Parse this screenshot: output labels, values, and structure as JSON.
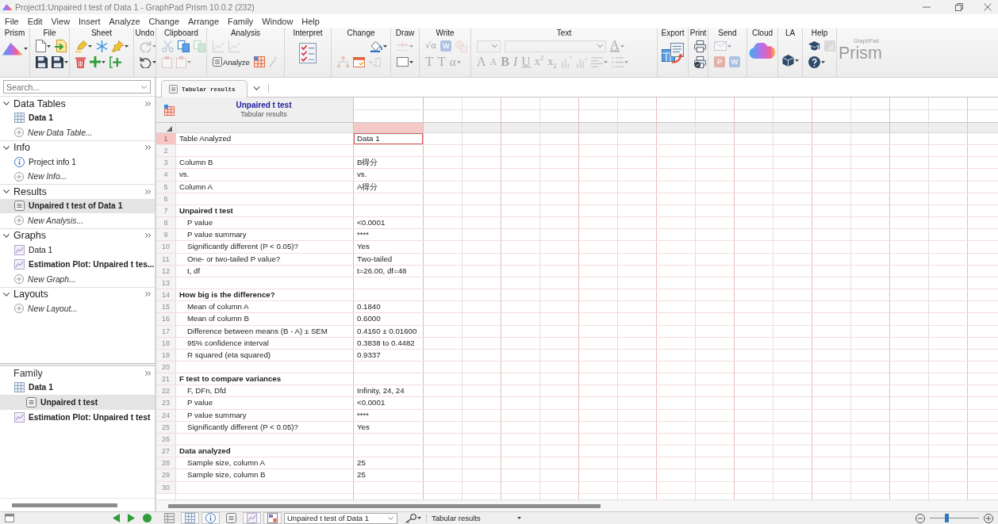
{
  "window": {
    "title": "Project1:Unpaired t test of Data 1 - GraphPad Prism 10.0.2 (232)"
  },
  "menu": [
    "File",
    "Edit",
    "View",
    "Insert",
    "Analyze",
    "Change",
    "Arrange",
    "Family",
    "Window",
    "Help"
  ],
  "ribbon": {
    "groups": [
      {
        "label": "Prism",
        "rows": [
          [
            {
              "kind": "icon",
              "disabled": false,
              "dropdown": true
            }
          ]
        ]
      },
      {
        "label": "File",
        "rows": [
          [
            {
              "kind": "icon",
              "disabled": false,
              "dropdown": true
            },
            {
              "kind": "icon",
              "disabled": false,
              "dropdown": false
            }
          ],
          [
            {
              "kind": "icon",
              "disabled": false,
              "dropdown": false
            },
            {
              "kind": "icon",
              "disabled": false,
              "dropdown": true
            }
          ]
        ]
      },
      {
        "label": "Sheet",
        "rows": [
          [
            {
              "kind": "icon",
              "disabled": false,
              "dropdown": true
            },
            {
              "kind": "icon",
              "disabled": false,
              "dropdown": false
            },
            {
              "kind": "icon",
              "disabled": false,
              "dropdown": true
            }
          ],
          [
            {
              "kind": "icon",
              "disabled": false,
              "dropdown": false
            },
            {
              "kind": "icon",
              "disabled": false,
              "dropdown": true
            },
            {
              "kind": "icon",
              "disabled": false,
              "dropdown": false
            }
          ]
        ]
      },
      {
        "label": "Undo",
        "rows": [
          [
            {
              "kind": "icon",
              "disabled": true,
              "dropdown": true
            }
          ],
          [
            {
              "kind": "icon",
              "disabled": false,
              "dropdown": true
            }
          ]
        ]
      },
      {
        "label": "Clipboard",
        "rows": [
          [
            {
              "kind": "icon",
              "disabled": true,
              "dropdown": false
            },
            {
              "kind": "icon",
              "disabled": false,
              "dropdown": false
            },
            {
              "kind": "icon",
              "disabled": true,
              "dropdown": false
            }
          ],
          [
            {
              "kind": "icon",
              "disabled": true,
              "dropdown": false
            },
            {
              "kind": "icon",
              "disabled": true,
              "dropdown": true
            }
          ]
        ]
      },
      {
        "label": "Analysis",
        "rows": [
          [
            {
              "kind": "icon",
              "disabled": true,
              "dropdown": false
            },
            {
              "kind": "icon",
              "disabled": true,
              "dropdown": false
            }
          ],
          [
            {
              "kind": "button",
              "label": "Analyze",
              "disabled": false,
              "dropdown": false
            },
            {
              "kind": "icon",
              "disabled": false,
              "dropdown": false
            },
            {
              "kind": "icon",
              "disabled": true,
              "dropdown": false
            }
          ]
        ]
      },
      {
        "label": "Interpret",
        "rows": [
          [
            {
              "kind": "icon",
              "disabled": false,
              "dropdown": false
            }
          ]
        ]
      },
      {
        "label": "Change",
        "rows": [
          [
            {
              "kind": "icon",
              "disabled": false,
              "dropdown": true
            }
          ],
          [
            {
              "kind": "icon",
              "disabled": true,
              "dropdown": false
            },
            {
              "kind": "icon",
              "disabled": false,
              "dropdown": false
            },
            {
              "kind": "icon",
              "disabled": true,
              "dropdown": false
            }
          ]
        ]
      },
      {
        "label": "Draw",
        "rows": [
          [
            {
              "kind": "icon",
              "disabled": true,
              "dropdown": true
            }
          ],
          [
            {
              "kind": "icon",
              "disabled": false,
              "dropdown": true
            }
          ]
        ]
      },
      {
        "label": "Write",
        "rows": [
          [
            {
              "kind": "glyph",
              "label": "√α",
              "disabled": true,
              "dropdown": false
            },
            {
              "kind": "tile",
              "label": "W",
              "disabled": true,
              "dropdown": false
            },
            {
              "kind": "icon",
              "disabled": true,
              "dropdown": false
            }
          ],
          [
            {
              "kind": "glyph",
              "label": "T",
              "disabled": true,
              "dropdown": false
            },
            {
              "kind": "glyph",
              "label": "T",
              "disabled": true,
              "dropdown": false
            },
            {
              "kind": "glyph",
              "label": "α",
              "disabled": true,
              "dropdown": true
            }
          ]
        ]
      },
      {
        "label": "Text",
        "rows": [
          [
            {
              "kind": "field",
              "disabled": true,
              "dropdown": true
            },
            {
              "kind": "field",
              "disabled": true,
              "dropdown": true
            },
            {
              "kind": "glyph",
              "label": "A",
              "disabled": true,
              "dropdown": true
            }
          ],
          [
            {
              "kind": "glyph",
              "label": "A",
              "disabled": true,
              "dropdown": false
            },
            {
              "kind": "glyph",
              "label": "A",
              "disabled": true,
              "dropdown": false
            },
            {
              "kind": "glyph",
              "label": "B",
              "disabled": true,
              "dropdown": false
            },
            {
              "kind": "glyph",
              "label": "I",
              "disabled": true,
              "dropdown": false
            },
            {
              "kind": "glyph",
              "label": "U",
              "disabled": true,
              "dropdown": false
            },
            {
              "kind": "glyph",
              "label": "x$^{2}$",
              "disabled": true,
              "dropdown": false
            },
            {
              "kind": "glyph",
              "label": "x$_{2}$",
              "disabled": true,
              "dropdown": false
            },
            {
              "kind": "icon",
              "disabled": true,
              "dropdown": false
            },
            {
              "kind": "icon",
              "disabled": true,
              "dropdown": false
            },
            {
              "kind": "icon",
              "disabled": true,
              "dropdown": true
            },
            {
              "kind": "icon",
              "disabled": true,
              "dropdown": true
            }
          ]
        ]
      },
      {
        "label": "Export",
        "rows": [
          [
            {
              "kind": "icon",
              "disabled": false,
              "dropdown": false
            }
          ]
        ]
      },
      {
        "label": "Print",
        "rows": [
          [
            {
              "kind": "icon",
              "disabled": false,
              "dropdown": false
            }
          ],
          [
            {
              "kind": "icon",
              "disabled": false,
              "dropdown": false
            }
          ]
        ]
      },
      {
        "label": "Send",
        "rows": [
          [
            {
              "kind": "icon",
              "disabled": true,
              "dropdown": true
            }
          ],
          [
            {
              "kind": "tile",
              "label": "P",
              "disabled": true,
              "dropdown": false
            },
            {
              "kind": "tile",
              "label": "W",
              "disabled": true,
              "dropdown": false
            }
          ]
        ]
      },
      {
        "label": "Cloud",
        "rows": [
          [
            {
              "kind": "icon",
              "disabled": false,
              "dropdown": false
            }
          ]
        ]
      },
      {
        "label": "LA",
        "rows": [
          [
            {
              "kind": "icon",
              "disabled": false,
              "dropdown": true
            }
          ]
        ]
      },
      {
        "label": "Help",
        "rows": [
          [
            {
              "kind": "icon",
              "disabled": false,
              "dropdown": false
            },
            {
              "kind": "icon",
              "disabled": true,
              "dropdown": false
            }
          ],
          [
            {
              "kind": "icon",
              "disabled": false,
              "dropdown": true
            }
          ]
        ]
      }
    ],
    "brand": {
      "caption": "GraphPad",
      "name": "Prism"
    }
  },
  "navigator": {
    "search": {
      "placeholder": "Search..."
    },
    "sections": [
      {
        "title": "Data Tables",
        "expanded": true,
        "items": [
          {
            "kind": "table",
            "label": "Data 1",
            "emphasized": true,
            "selected": false
          },
          {
            "kind": "new",
            "label": "New Data Table...",
            "emphasized": false,
            "selected": false
          }
        ]
      },
      {
        "title": "Info",
        "expanded": true,
        "items": [
          {
            "kind": "info",
            "label": "Project info 1",
            "emphasized": false,
            "selected": false
          },
          {
            "kind": "new",
            "label": "New Info...",
            "emphasized": false,
            "selected": false
          }
        ]
      },
      {
        "title": "Results",
        "expanded": true,
        "items": [
          {
            "kind": "results",
            "label": "Unpaired t test of Data 1",
            "emphasized": true,
            "selected": true
          },
          {
            "kind": "new",
            "label": "New Analysis...",
            "emphasized": false,
            "selected": false
          }
        ]
      },
      {
        "title": "Graphs",
        "expanded": true,
        "items": [
          {
            "kind": "graph",
            "label": "Data 1",
            "emphasized": false,
            "selected": false
          },
          {
            "kind": "graph",
            "label": "Estimation Plot: Unpaired t tes...",
            "emphasized": true,
            "selected": false
          },
          {
            "kind": "new",
            "label": "New Graph...",
            "emphasized": false,
            "selected": false
          }
        ]
      },
      {
        "title": "Layouts",
        "expanded": true,
        "items": [
          {
            "kind": "new",
            "label": "New Layout...",
            "emphasized": false,
            "selected": false
          }
        ]
      }
    ]
  },
  "family": {
    "title": "Family",
    "items": [
      {
        "kind": "table",
        "label": "Data 1",
        "emphasized": true,
        "selected": false,
        "children": [
          {
            "kind": "results",
            "label": "Unpaired t test",
            "emphasized": true,
            "selected": true
          }
        ]
      },
      {
        "kind": "graph",
        "label": "Estimation Plot: Unpaired t test",
        "emphasized": true,
        "selected": false
      }
    ]
  },
  "sheet_tabs": [
    {
      "label": "Tabular results",
      "selected": true
    }
  ],
  "sheet": {
    "title": "Unpaired t test",
    "subtitle": "Tabular results",
    "columns": [
      {
        "selected": false
      },
      {
        "selected": true
      }
    ],
    "rows": [
      {
        "number": "1",
        "kind": "plain",
        "label": "Table Analyzed",
        "value": "Data 1",
        "selected": true
      },
      {
        "number": "2",
        "kind": "blank",
        "selected": false
      },
      {
        "number": "3",
        "kind": "plain",
        "label": "Column B",
        "value": "B得分",
        "selected": false
      },
      {
        "number": "4",
        "kind": "plain",
        "label": "vs.",
        "value": "vs.",
        "selected": false
      },
      {
        "number": "5",
        "kind": "plain",
        "label": "Column A",
        "value": "A得分",
        "selected": false
      },
      {
        "number": "6",
        "kind": "blank",
        "selected": false
      },
      {
        "number": "7",
        "kind": "heading",
        "label": "Unpaired t test",
        "selected": false
      },
      {
        "number": "8",
        "kind": "indented",
        "label": "P value",
        "value": "<0.0001",
        "selected": false
      },
      {
        "number": "9",
        "kind": "indented",
        "label": "P value summary",
        "value": "****",
        "selected": false
      },
      {
        "number": "10",
        "kind": "indented",
        "label": "Significantly different (P < 0.05)?",
        "value": "Yes",
        "selected": false
      },
      {
        "number": "11",
        "kind": "indented",
        "label": "One- or two-tailed P value?",
        "value": "Two-tailed",
        "selected": false
      },
      {
        "number": "12",
        "kind": "indented",
        "label": "t, df",
        "value": "t=26.00, df=48",
        "selected": false
      },
      {
        "number": "13",
        "kind": "blank",
        "selected": false
      },
      {
        "number": "14",
        "kind": "heading",
        "label": "How big is the difference?",
        "selected": false
      },
      {
        "number": "15",
        "kind": "indented",
        "label": "Mean of column A",
        "value": "0.1840",
        "selected": false
      },
      {
        "number": "16",
        "kind": "indented",
        "label": "Mean of column B",
        "value": "0.6000",
        "selected": false
      },
      {
        "number": "17",
        "kind": "indented",
        "label": "Difference between means (B - A) ± SEM",
        "value": "0.4160 ± 0.01600",
        "selected": false
      },
      {
        "number": "18",
        "kind": "indented",
        "label": "95% confidence interval",
        "value": "0.3838 to 0.4482",
        "selected": false
      },
      {
        "number": "19",
        "kind": "indented",
        "label": "R squared (eta squared)",
        "value": "0.9337",
        "selected": false
      },
      {
        "number": "20",
        "kind": "blank",
        "selected": false
      },
      {
        "number": "21",
        "kind": "heading",
        "label": "F test to compare variances",
        "selected": false
      },
      {
        "number": "22",
        "kind": "indented",
        "label": "F, DFn, Dfd",
        "value": "Infinity, 24, 24",
        "selected": false
      },
      {
        "number": "23",
        "kind": "indented",
        "label": "P value",
        "value": "<0.0001",
        "selected": false
      },
      {
        "number": "24",
        "kind": "indented",
        "label": "P value summary",
        "value": "****",
        "selected": false
      },
      {
        "number": "25",
        "kind": "indented",
        "label": "Significantly different (P < 0.05)?",
        "value": "Yes",
        "selected": false
      },
      {
        "number": "26",
        "kind": "blank",
        "selected": false
      },
      {
        "number": "27",
        "kind": "heading",
        "label": "Data analyzed",
        "selected": false
      },
      {
        "number": "28",
        "kind": "indented",
        "label": "Sample size, column A",
        "value": "25",
        "selected": false
      },
      {
        "number": "29",
        "kind": "indented",
        "label": "Sample size, column B",
        "value": "25",
        "selected": false
      },
      {
        "number": "30",
        "kind": "blank",
        "selected": false
      }
    ]
  },
  "status_bar": {
    "view_buttons": [
      {
        "pressed": false
      },
      {
        "pressed": true
      },
      {
        "pressed": true
      },
      {
        "pressed": false
      },
      {
        "pressed": true
      },
      {
        "pressed": true
      }
    ],
    "sheet_selector": "Unpaired t test of Data 1",
    "view_selector": "Tabular results",
    "zoom": {
      "level": 0.35
    }
  }
}
